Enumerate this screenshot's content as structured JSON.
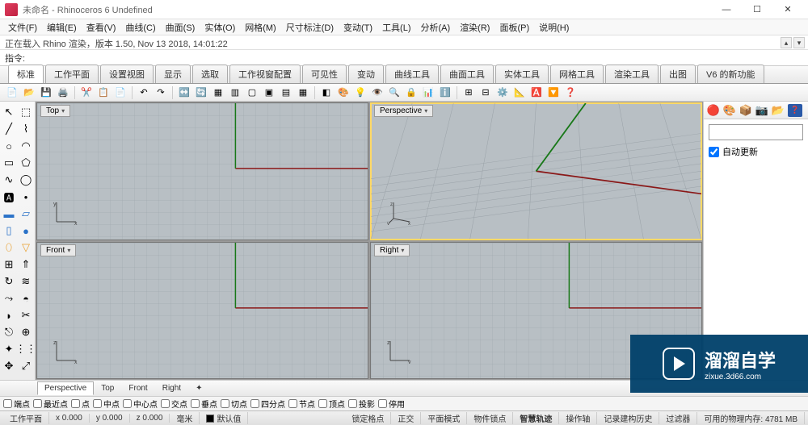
{
  "title": "未命名 - Rhinoceros 6 Undefined",
  "menubar": [
    "文件(F)",
    "编辑(E)",
    "查看(V)",
    "曲线(C)",
    "曲面(S)",
    "实体(O)",
    "网格(M)",
    "尺寸标注(D)",
    "变动(T)",
    "工具(L)",
    "分析(A)",
    "渲染(R)",
    "面板(P)",
    "说明(H)"
  ],
  "history_text": "正在载入 Rhino 渲染，版本 1.50, Nov 13 2018, 14:01:22",
  "command_label": "指令:",
  "command_value": "",
  "tabs": [
    "标准",
    "工作平面",
    "设置视图",
    "显示",
    "选取",
    "工作视窗配置",
    "可见性",
    "变动",
    "曲线工具",
    "曲面工具",
    "实体工具",
    "网格工具",
    "渲染工具",
    "出图",
    "V6 的新功能"
  ],
  "viewports": {
    "tl": {
      "label": "Top",
      "active": false
    },
    "tr": {
      "label": "Perspective",
      "active": true
    },
    "bl": {
      "label": "Front",
      "active": false
    },
    "br": {
      "label": "Right",
      "active": false
    }
  },
  "right_panel": {
    "auto_update": "自动更新",
    "auto_update_checked": true
  },
  "view_tabs": [
    "Perspective",
    "Top",
    "Front",
    "Right"
  ],
  "osnaps": [
    "端点",
    "最近点",
    "点",
    "中点",
    "中心点",
    "交点",
    "垂点",
    "切点",
    "四分点",
    "节点",
    "顶点",
    "投影",
    "停用"
  ],
  "status": {
    "cplane": "工作平面",
    "x": "x 0.000",
    "y": "y 0.000",
    "z": "z 0.000",
    "units": "毫米",
    "layer": "默认值",
    "gridsnap": "锁定格点",
    "ortho": "正交",
    "planar": "平面模式",
    "osnap": "物件锁点",
    "smart": "智慧轨迹",
    "gumball": "操作轴",
    "recordhist": "记录建构历史",
    "filter": "过滤器",
    "memory": "可用的物理内存: 4781 MB"
  },
  "watermark": {
    "main": "溜溜自学",
    "sub": "zixue.3d66.com"
  }
}
